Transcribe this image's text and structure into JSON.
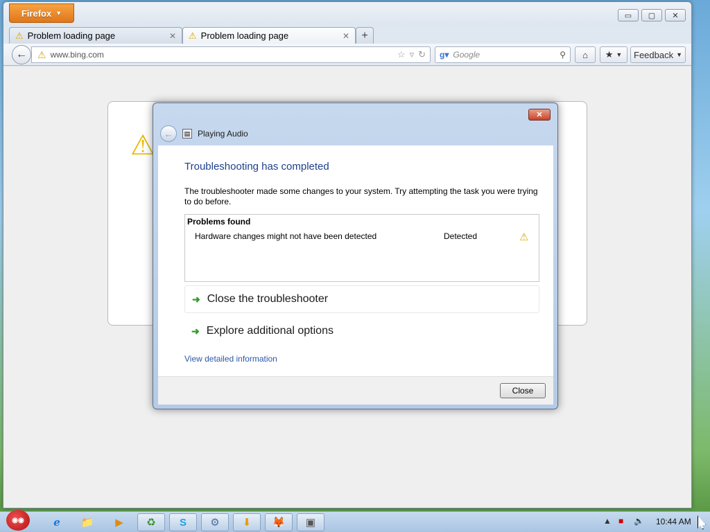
{
  "browser": {
    "app_button_label": "Firefox",
    "tabs": [
      {
        "label": "Problem loading page"
      },
      {
        "label": "Problem loading page"
      }
    ],
    "new_tab_label": "+",
    "url": "www.bing.com",
    "search_placeholder": "Google",
    "feedback_label": "Feedback",
    "window_controls": {
      "minimize": "▭",
      "maximize": "▢",
      "close": "✕"
    }
  },
  "dialog": {
    "title": "Playing Audio",
    "close_glyph": "✕",
    "heading": "Troubleshooting has completed",
    "description": "The troubleshooter made some changes to your system. Try attempting the task you were trying to do before.",
    "problems_header": "Problems found",
    "problems": [
      {
        "name": "Hardware changes might not have been detected",
        "status": "Detected",
        "icon": "warning-icon"
      }
    ],
    "options": [
      {
        "label": "Close the troubleshooter"
      },
      {
        "label": "Explore additional options"
      }
    ],
    "details_link": "View detailed information",
    "close_button": "Close"
  },
  "taskbar": {
    "items": [
      {
        "icon": "ie-icon",
        "glyph": "e"
      },
      {
        "icon": "folder-icon",
        "glyph": "📁"
      },
      {
        "icon": "media-player-icon",
        "glyph": "▶"
      },
      {
        "icon": "recycle-icon",
        "glyph": "♻"
      },
      {
        "icon": "skype-icon",
        "glyph": "S"
      },
      {
        "icon": "network-icon",
        "glyph": "⚙"
      },
      {
        "icon": "download-icon",
        "glyph": "⬇"
      },
      {
        "icon": "firefox-icon",
        "glyph": "🦊"
      },
      {
        "icon": "troubleshooter-icon",
        "glyph": "▣"
      }
    ],
    "clock": "10:44 AM"
  },
  "colors": {
    "firefox_orange": "#e0761a",
    "dialog_heading_blue": "#1e3f8a",
    "link_blue": "#2a58a8",
    "warning_yellow": "#d8b000",
    "arrow_green": "#2f9d27"
  }
}
